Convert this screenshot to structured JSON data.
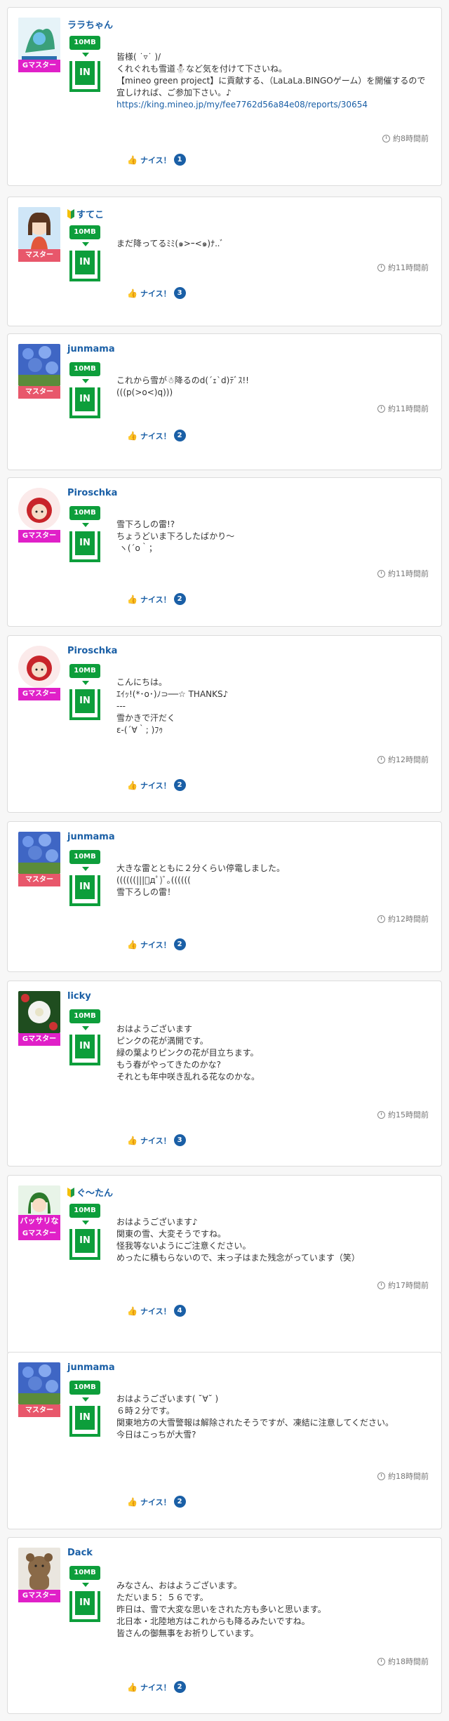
{
  "posts": [
    {
      "user": "ララちゃん",
      "rank": "Gマスター",
      "capacity": "10MB",
      "inbox": "IN",
      "message": "皆様( ˙▿˙ )/\nくれぐれも雪道⛄️など気を付けて下さいね。\n【mineo green project】に貢献する、（LaLaLa.BINGOゲーム）を開催するので宜しければ、ご参加下さい。♪",
      "link": "https://king.mineo.jp/my/fee7762d56a84e08/reports/30654",
      "time": "約8時間前",
      "nice_label": "ナイス！",
      "nice_count": "1"
    },
    {
      "user": "すてこ",
      "rank": "マスター",
      "capacity": "10MB",
      "inbox": "IN",
      "message": "まだ降ってるﾐﾐ(๑>ｰ<๑)ﾅ..ﾞ",
      "time": "約11時間前",
      "nice_label": "ナイス！",
      "nice_count": "3"
    },
    {
      "user": "junmama",
      "rank": "マスター",
      "capacity": "10MB",
      "inbox": "IN",
      "message": "これから雪が☃降るのd(´ｪ`d)ﾃﾞｽ!!\n(((p(>o<)q)))",
      "time": "約11時間前",
      "nice_label": "ナイス！",
      "nice_count": "2"
    },
    {
      "user": "Piroschka",
      "rank": "Gマスター",
      "capacity": "10MB",
      "inbox": "IN",
      "message": "雪下ろしの雷!?\nちょうどいま下ろしたばかり〜\n ヽ(´o｀；",
      "time": "約11時間前",
      "nice_label": "ナイス！",
      "nice_count": "2"
    },
    {
      "user": "Piroschka",
      "rank": "Gマスター",
      "capacity": "10MB",
      "inbox": "IN",
      "message": "こんにちは。\nｴｲｯ!(*･o･)ﾉ⊃──☆ THANKS♪\n---\n雪かきで汗だく\nε-(´∀｀; )ﾌｩ",
      "time": "約12時間前",
      "nice_label": "ナイス！",
      "nice_count": "2"
    },
    {
      "user": "junmama",
      "rank": "マスター",
      "capacity": "10MB",
      "inbox": "IN",
      "message": "大きな雷とともに２分くらい停電しました。\n((((((|||ﾟдﾟ)ﾞ｡((((((\n雪下ろしの雷！",
      "time": "約12時間前",
      "nice_label": "ナイス！",
      "nice_count": "2"
    },
    {
      "user": "licky",
      "rank": "Gマスター",
      "capacity": "10MB",
      "inbox": "IN",
      "message": "おはようございます\nピンクの花が満開です。\n緑の葉よりピンクの花が目立ちます。\nもう春がやってきたのかな?\nそれとも年中咲き乱れる花なのかな。",
      "time": "約15時間前",
      "nice_label": "ナイス！",
      "nice_count": "3"
    },
    {
      "user": "ぐ〜たん",
      "rank": "Gマスター",
      "rank_top": "バッサリな",
      "capacity": "10MB",
      "inbox": "IN",
      "message": "おはようございます♪\n関東の雪、大変そうですね。\n怪我等ないようにご注意ください。\nめったに積もらないので、末っ子はまた残念がっています（笑）",
      "time": "約17時間前",
      "nice_label": "ナイス！",
      "nice_count": "4"
    },
    {
      "user": "junmama",
      "rank": "マスター",
      "capacity": "10MB",
      "inbox": "IN",
      "message": "おはようございます( ˘∀˘ )\n６時２分です。\n関東地方の大雪警報は解除されたそうですが、凍結に注意してください。\n今日はこっちが大雪?",
      "time": "約18時間前",
      "nice_label": "ナイス！",
      "nice_count": "2"
    },
    {
      "user": "Dack",
      "rank": "Gマスター",
      "capacity": "10MB",
      "inbox": "IN",
      "message": "みなさん、おはようございます。\nただいま５：５６です。\n昨日は、雪で大変な思いをされた方も多いと思います。\n北日本・北陸地方はこれからも降るみたいですね。\n皆さんの御無事をお祈りしています。",
      "time": "約18時間前",
      "nice_label": "ナイス！",
      "nice_count": "2"
    }
  ]
}
